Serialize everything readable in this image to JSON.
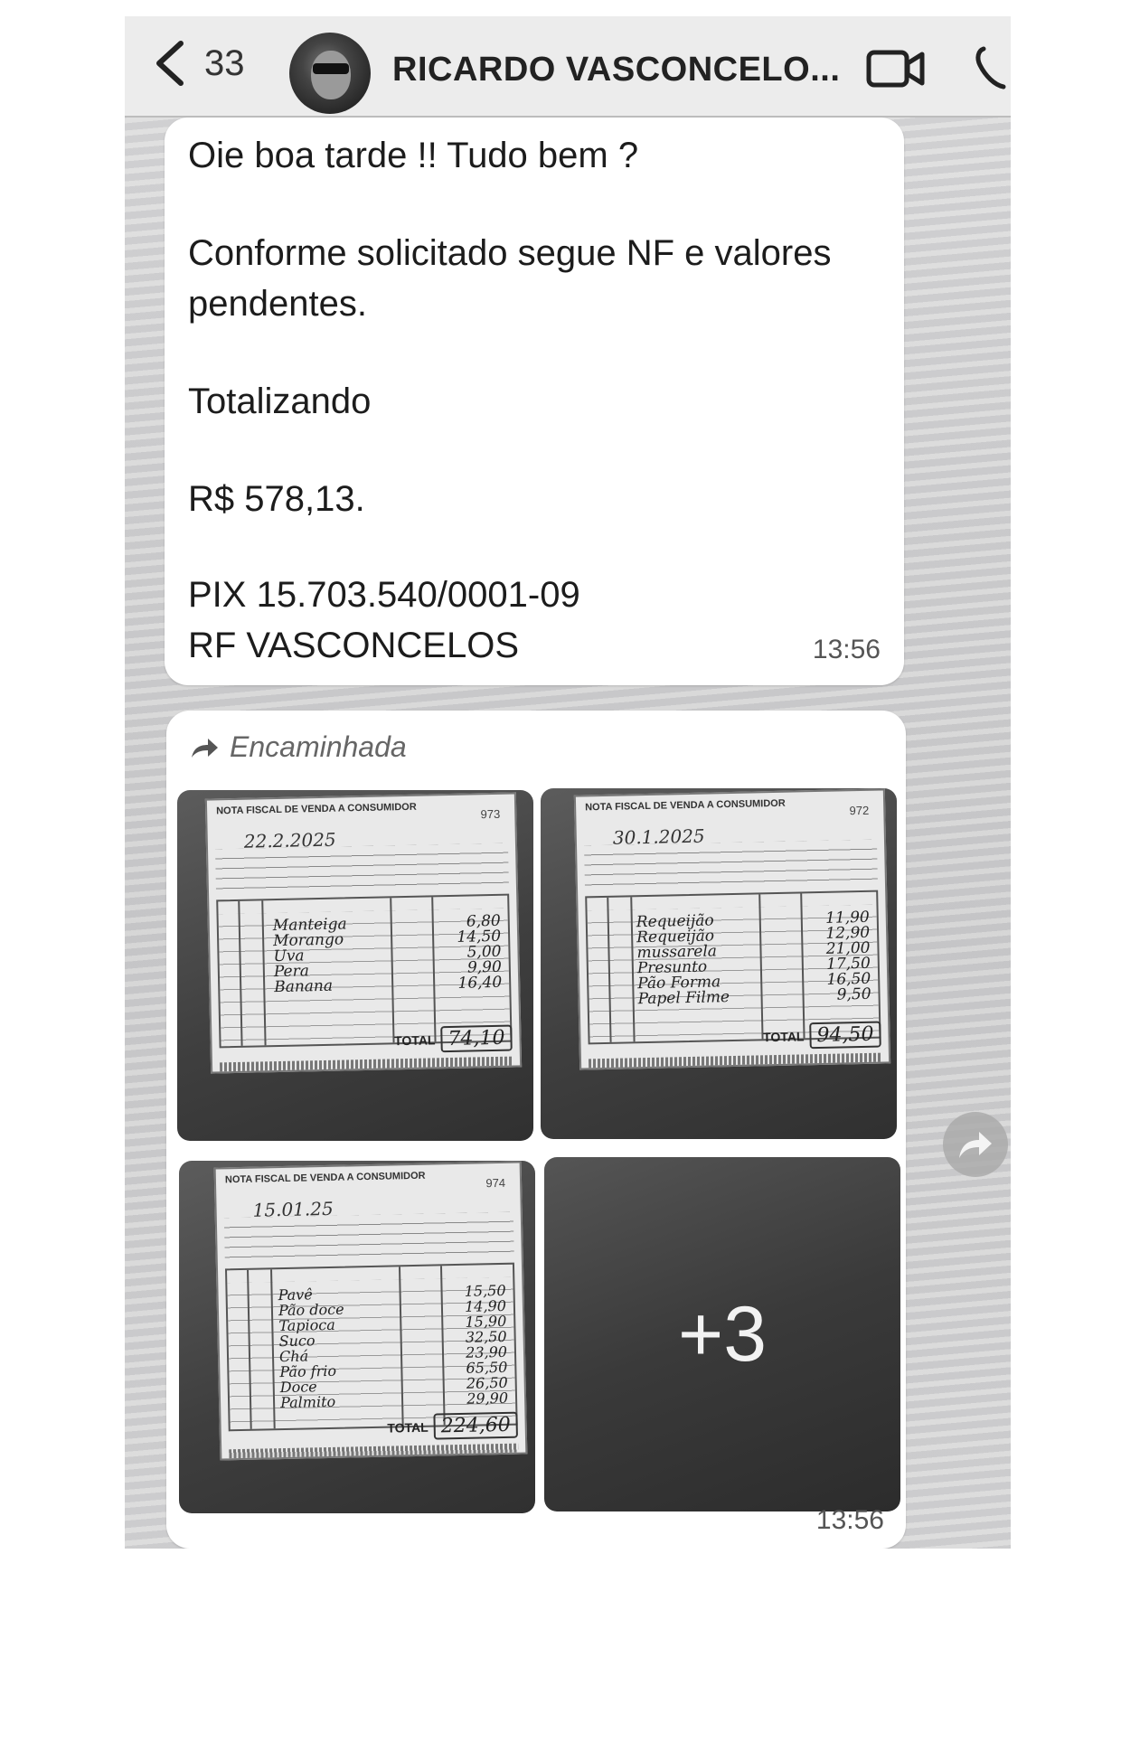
{
  "header": {
    "back_count": "33",
    "contact_name": "RICARDO VASCONCELO..."
  },
  "message_1": {
    "lines": [
      "Oie boa tarde !! Tudo bem  ?",
      "Conforme solicitado segue NF e valores",
      "pendentes.",
      "Totalizando",
      "R$ 578,13.",
      "PIX 15.703.540/0001-09",
      "RF VASCONCELOS"
    ],
    "time": "13:56"
  },
  "message_2": {
    "forwarded_label": "Encaminhada",
    "time": "13:56",
    "more_count": "+3",
    "receipts": [
      {
        "number": "973",
        "date": "22.2.2025",
        "items": [
          "Manteiga",
          "Morango",
          "Uva",
          "Pera",
          "Banana"
        ],
        "values": [
          "6,80",
          "14,50",
          "5,00",
          "9,90",
          "16,40"
        ],
        "total_label": "TOTAL",
        "total": "74,10"
      },
      {
        "number": "972",
        "date": "30.1.2025",
        "items": [
          "Requeijão",
          "Requeijão",
          "mussarela",
          "Presunto",
          "Pão Forma",
          "Papel Filme"
        ],
        "values": [
          "11,90",
          "12,90",
          "21,00",
          "17,50",
          "16,50",
          "9,50"
        ],
        "total_label": "TOTAL",
        "total": "94,50"
      },
      {
        "number": "974",
        "date": "15.01.25",
        "items": [
          "Pavê",
          "Pão doce",
          "Tapioca",
          "Suco",
          "Chá",
          "Pão frio",
          "Doce",
          "Palmito"
        ],
        "values": [
          "15,50",
          "14,90",
          "15,90",
          "32,50",
          "23,90",
          "65,50",
          "26,50",
          "29,90"
        ],
        "total_label": "TOTAL",
        "total": "224,60"
      }
    ]
  },
  "icons": {
    "back": "chevron-left-icon",
    "video": "video-camera-icon",
    "call": "phone-icon",
    "forward": "forward-arrow-icon",
    "share": "share-arrow-icon"
  }
}
